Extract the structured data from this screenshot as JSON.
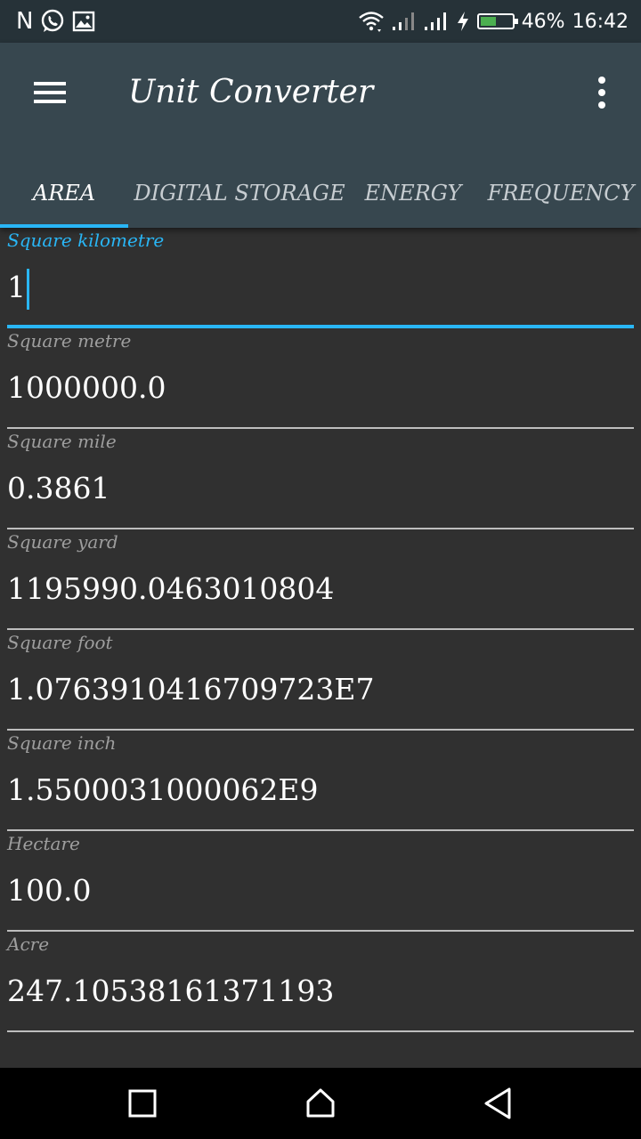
{
  "status_bar": {
    "notification_letter": "N",
    "notification_icons": [
      "whatsapp-icon",
      "image-icon"
    ],
    "system_icons": [
      "wifi-icon",
      "signal-icon",
      "signal-icon",
      "charging-icon",
      "battery-icon"
    ],
    "battery_level": 0.46,
    "battery_text": "46%",
    "time": "16:42",
    "battery_color": "#4caf50"
  },
  "app_bar": {
    "title": "Unit Converter",
    "menu_icon": "hamburger-menu-icon",
    "overflow_icon": "more-vert-icon",
    "background": "#37474f"
  },
  "tabs": [
    {
      "label": "AREA",
      "active": true
    },
    {
      "label": "DIGITAL STORAGE",
      "active": false
    },
    {
      "label": "ENERGY",
      "active": false
    },
    {
      "label": "FREQUENCY",
      "active": false
    }
  ],
  "accent_color": "#29b6f6",
  "fields": [
    {
      "label": "Square kilometre",
      "value": "1",
      "focused": true
    },
    {
      "label": "Square metre",
      "value": "1000000.0"
    },
    {
      "label": "Square mile",
      "value": "0.3861"
    },
    {
      "label": "Square yard",
      "value": "1195990.0463010804"
    },
    {
      "label": "Square foot",
      "value": "1.0763910416709723E7"
    },
    {
      "label": "Square inch",
      "value": "1.5500031000062E9"
    },
    {
      "label": "Hectare",
      "value": "100.0"
    },
    {
      "label": "Acre",
      "value": "247.10538161371193"
    }
  ],
  "nav_bar": {
    "buttons": [
      "recents-square-icon",
      "home-icon",
      "back-triangle-icon"
    ]
  }
}
